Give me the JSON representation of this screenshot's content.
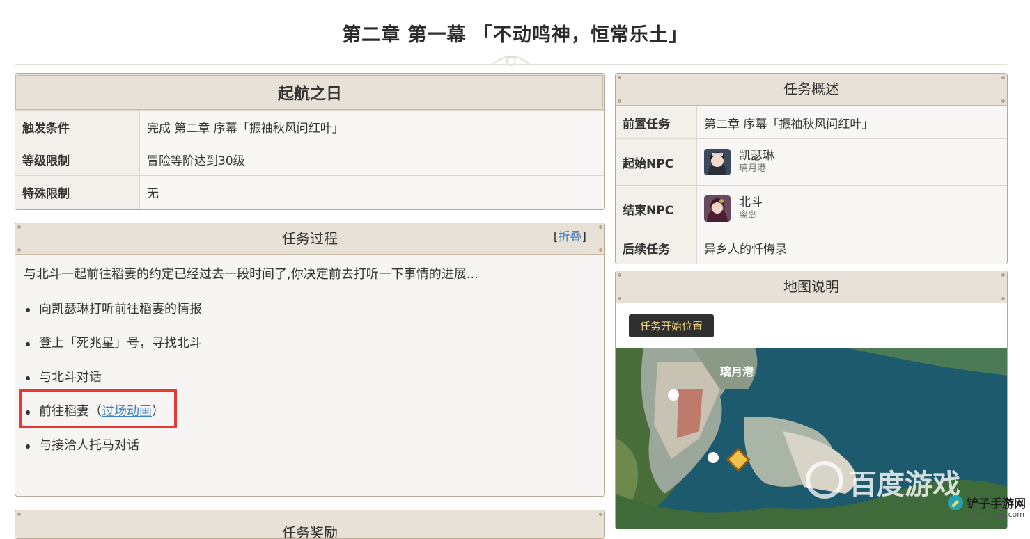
{
  "page": {
    "title": "第二章 第一幕 「不动鸣神，恒常乐土」"
  },
  "info": {
    "heading": "起航之日",
    "rows": [
      {
        "key": "触发条件",
        "value": "完成 第二章 序幕「振袖秋风问红叶」"
      },
      {
        "key": "等级限制",
        "value": "冒险等阶达到30级"
      },
      {
        "key": "特殊限制",
        "value": "无"
      }
    ]
  },
  "process": {
    "heading": "任务过程",
    "collapse_open": "[",
    "collapse_label": "折叠",
    "collapse_close": "]",
    "intro": "与北斗一起前往稻妻的约定已经过去一段时间了,你决定前去打听一下事情的进展...",
    "steps": [
      {
        "text": "向凯瑟琳打听前往稻妻的情报"
      },
      {
        "text": "登上「死兆星」号，寻找北斗"
      },
      {
        "text": "与北斗对话"
      },
      {
        "text": "前往稻妻（",
        "link": "过场动画",
        "suffix": "）"
      },
      {
        "text": "与接洽人托马对话"
      }
    ]
  },
  "next_panel": {
    "heading": "任务奖励"
  },
  "overview": {
    "heading": "任务概述",
    "prev_key": "前置任务",
    "prev_value": "第二章 序幕「振袖秋风问红叶」",
    "start_key": "起始NPC",
    "start_name": "凯瑟琳",
    "start_location": "璃月港",
    "end_key": "结束NPC",
    "end_name": "北斗",
    "end_location": "离岛",
    "next_key": "后续任务",
    "next_value": "异乡人的忏悔录"
  },
  "map": {
    "heading": "地图说明",
    "button_label": "任务开始位置",
    "place_label": "璃月港",
    "watermark_brand": "百度游戏",
    "watermark_site": "www.czjxjc.com",
    "site_logo": "铲子手游网"
  },
  "colors": {
    "accent_red": "#e53935",
    "link": "#3c7fc4",
    "header_bg": "#e8e1d8",
    "panel_border": "#b9aa95"
  }
}
